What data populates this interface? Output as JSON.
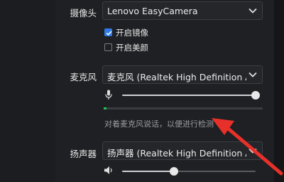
{
  "camera": {
    "label": "摄像头",
    "device": "Lenovo EasyCamera",
    "mirror": {
      "label": "开启镜像",
      "checked": true
    },
    "beauty": {
      "label": "开启美颜",
      "checked": false
    }
  },
  "microphone": {
    "label": "麦克风",
    "device": "麦克风 (Realtek High Definition Aud",
    "volume": 1.0,
    "input_level": 0.02,
    "hint": "对着麦克风说话，以便进行检测"
  },
  "speaker": {
    "label": "扬声器",
    "device": "扬声器 (Realtek High Definition Aud",
    "volume": 0.39
  },
  "colors": {
    "accent": "#2f7be6",
    "level": "#22c25a",
    "arrow": "#e8302a"
  },
  "icons": {
    "mic": "microphone-icon",
    "speaker": "speaker-icon",
    "dropdown": "chevron-down-icon"
  }
}
